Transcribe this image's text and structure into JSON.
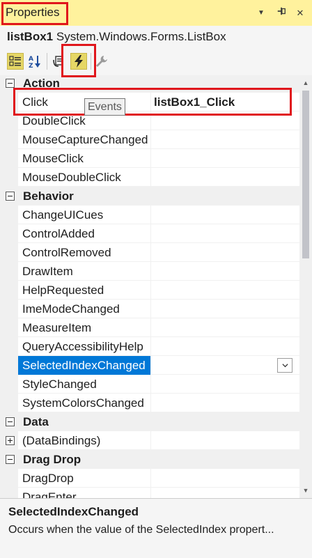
{
  "window": {
    "title": "Properties",
    "dropdown_glyph": "▼",
    "pin_glyph": "⊸",
    "close_glyph": "✕"
  },
  "object_bar": {
    "name": "listBox1",
    "type": "System.Windows.Forms.ListBox"
  },
  "toolbar": {
    "items": [
      "categorized-icon",
      "alphabetical-icon",
      "properties-icon",
      "events-icon",
      "property-pages-icon"
    ],
    "active": "events-icon",
    "active_color": "#e6d766"
  },
  "tooltip": "Events",
  "grid": {
    "categories": [
      {
        "label": "Action",
        "expanded": true
      },
      {
        "label": "Behavior",
        "expanded": true
      },
      {
        "label": "Data",
        "expanded": true
      },
      {
        "label": "Drag Drop",
        "expanded": true
      }
    ],
    "rows": {
      "click": {
        "name": "Click",
        "value": "listBox1_Click"
      },
      "double_click": {
        "name": "DoubleClick",
        "value": ""
      },
      "mouse_capture_changed": {
        "name": "MouseCaptureChanged",
        "value": ""
      },
      "mouse_click": {
        "name": "MouseClick",
        "value": ""
      },
      "mouse_double_click": {
        "name": "MouseDoubleClick",
        "value": ""
      },
      "change_ui_cues": {
        "name": "ChangeUICues",
        "value": ""
      },
      "control_added": {
        "name": "ControlAdded",
        "value": ""
      },
      "control_removed": {
        "name": "ControlRemoved",
        "value": ""
      },
      "draw_item": {
        "name": "DrawItem",
        "value": ""
      },
      "help_requested": {
        "name": "HelpRequested",
        "value": ""
      },
      "ime_mode_changed": {
        "name": "ImeModeChanged",
        "value": ""
      },
      "measure_item": {
        "name": "MeasureItem",
        "value": ""
      },
      "query_accessibility_help": {
        "name": "QueryAccessibilityHelp",
        "value": ""
      },
      "selected_index_changed": {
        "name": "SelectedIndexChanged",
        "value": ""
      },
      "style_changed": {
        "name": "StyleChanged",
        "value": ""
      },
      "system_colors_changed": {
        "name": "SystemColorsChanged",
        "value": ""
      },
      "data_bindings": {
        "name": "(DataBindings)",
        "value": ""
      },
      "drag_drop": {
        "name": "DragDrop",
        "value": ""
      },
      "drag_enter": {
        "name": "DragEnter",
        "value": ""
      }
    },
    "selected": "SelectedIndexChanged",
    "selected_color": "#0078d7"
  },
  "description": {
    "title": "SelectedIndexChanged",
    "text": "Occurs when the value of the SelectedIndex propert..."
  },
  "highlight_color": "#e0161c"
}
